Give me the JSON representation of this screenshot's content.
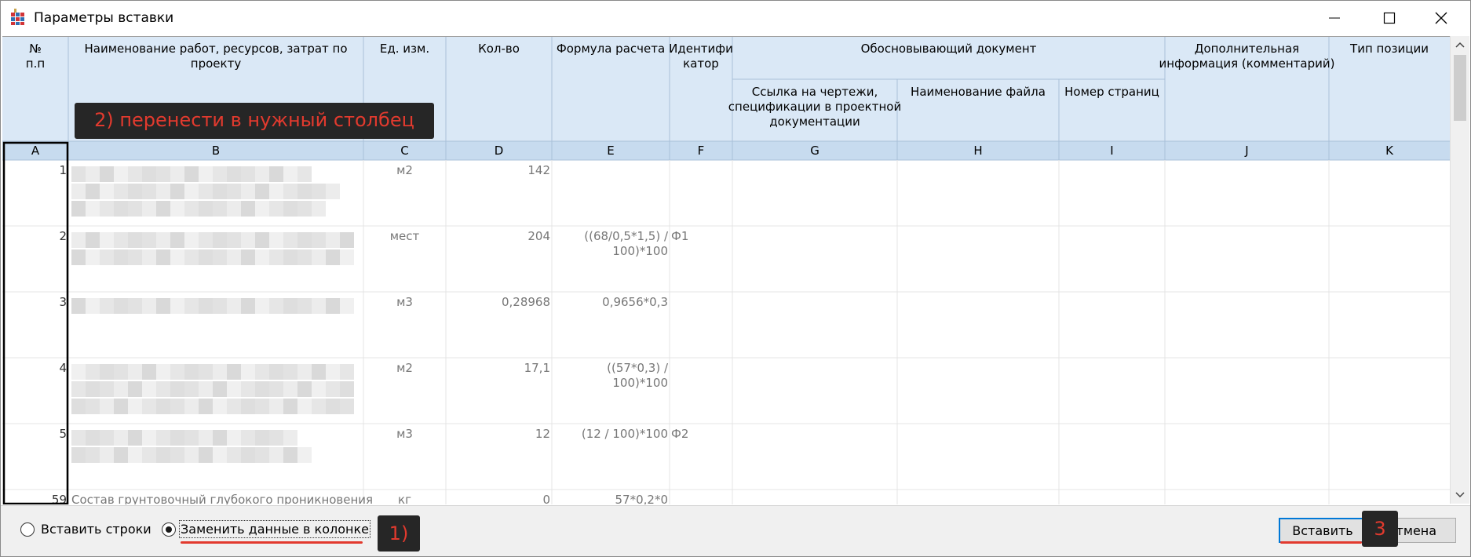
{
  "window": {
    "title": "Параметры вставки"
  },
  "columns": [
    {
      "letter": "A",
      "header": [
        "№",
        "п.п"
      ]
    },
    {
      "letter": "B",
      "header": [
        "Наименование работ, ресурсов, затрат по",
        "проекту"
      ]
    },
    {
      "letter": "C",
      "header": [
        "Ед. изм."
      ]
    },
    {
      "letter": "D",
      "header": [
        "Кол-во"
      ]
    },
    {
      "letter": "E",
      "header": [
        "Формула расчета"
      ]
    },
    {
      "letter": "F",
      "header": [
        "Идентифи",
        "катор"
      ]
    },
    {
      "letter": "G",
      "header": [
        "Ссылка на чертежи,",
        "спецификации в проектной",
        "документации"
      ]
    },
    {
      "letter": "H",
      "header": [
        "Наименование файла"
      ]
    },
    {
      "letter": "I",
      "header": [
        "Номер страниц"
      ]
    },
    {
      "letter": "J",
      "header": [
        "Дополнительная",
        "информация (комментарий)"
      ]
    },
    {
      "letter": "K",
      "header": [
        "Тип позиции"
      ]
    }
  ],
  "group_header": "Обосновывающий документ",
  "rows": [
    {
      "n": "1",
      "unit": "м2",
      "qty": "142",
      "formula": [],
      "id": ""
    },
    {
      "n": "2",
      "unit": "мест",
      "qty": "204",
      "formula": [
        "((68/0,5*1,5) /",
        "100)*100"
      ],
      "id": "Ф1"
    },
    {
      "n": "3",
      "unit": "м3",
      "qty": "0,28968",
      "formula": [
        "0,9656*0,3"
      ],
      "id": ""
    },
    {
      "n": "4",
      "unit": "м2",
      "qty": "17,1",
      "formula": [
        "((57*0,3) /",
        "100)*100"
      ],
      "id": ""
    },
    {
      "n": "5",
      "unit": "м3",
      "qty": "12",
      "formula": [
        "(12 / 100)*100"
      ],
      "id": "Ф2"
    },
    {
      "n": "59",
      "name": "Состав грунтовочный глубокого проникновения",
      "unit": "кг",
      "qty": "0",
      "formula": [
        "57*0,2*0"
      ],
      "id": ""
    }
  ],
  "options": {
    "insert_rows": "Вставить строки",
    "replace_data": "Заменить данные в колонке",
    "selected": "replace_data"
  },
  "buttons": {
    "insert": "Вставить",
    "cancel": "Отмена"
  },
  "annotations": {
    "step1": "1)",
    "step2": "2) перенести в нужный столбец",
    "step3": "3"
  }
}
